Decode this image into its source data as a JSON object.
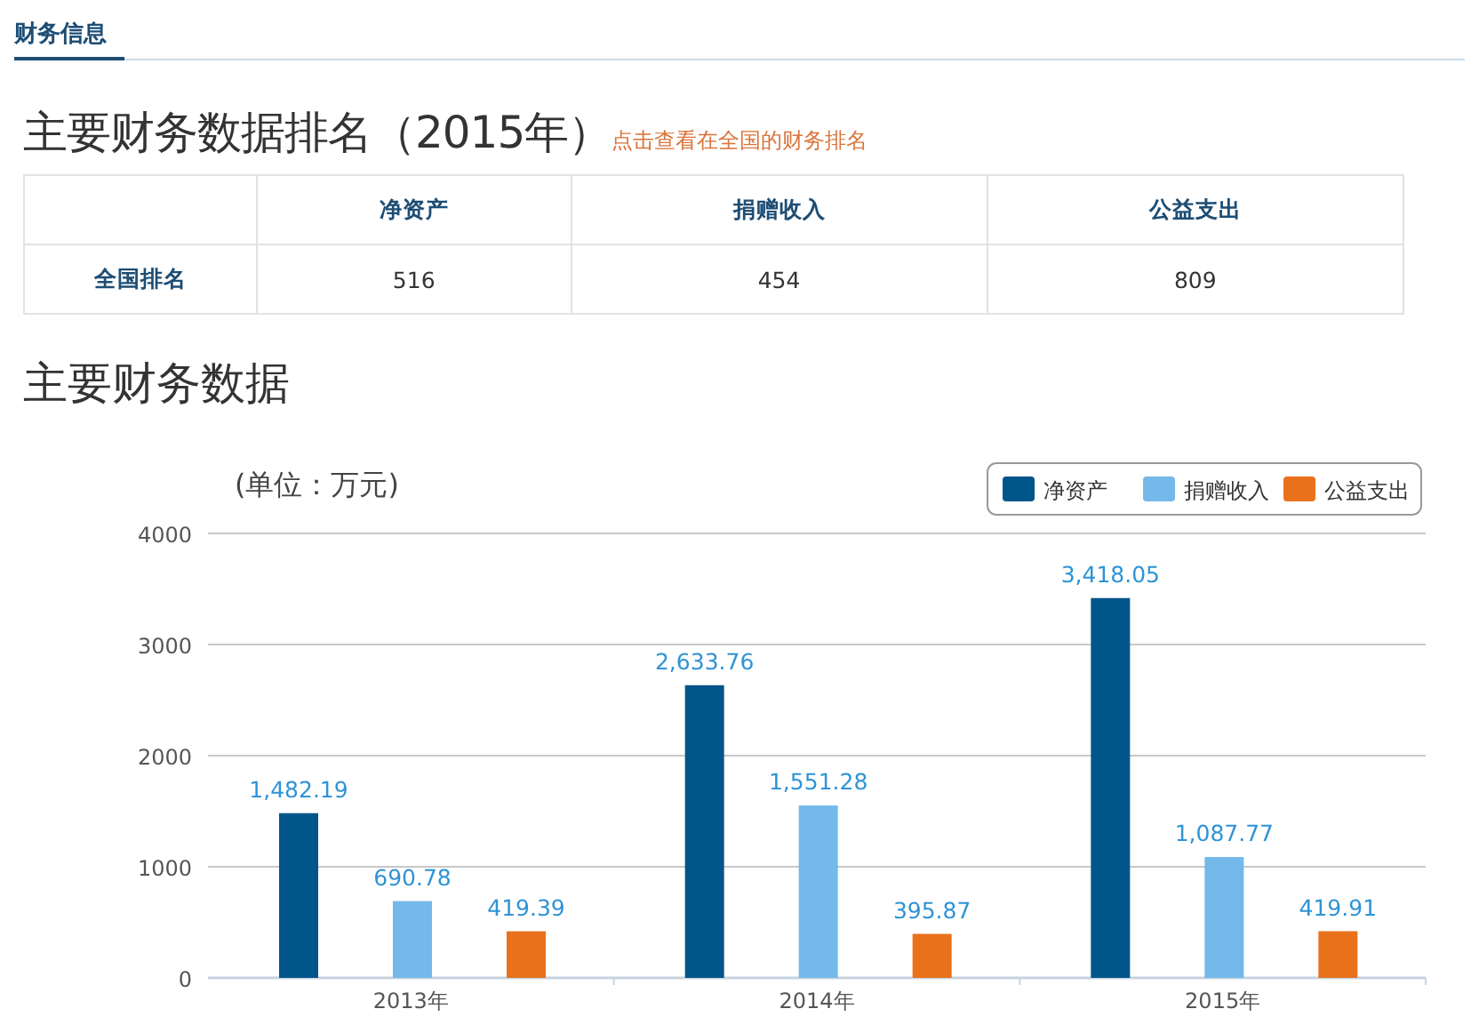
{
  "tabs": [
    {
      "label": "财务信息",
      "selected": true
    }
  ],
  "ranking": {
    "title": "主要财务数据排名（2015年）",
    "link": "点击查看在全国的财务排名",
    "columns": [
      "净资产",
      "捐赠收入",
      "公益支出"
    ],
    "rows": [
      {
        "label": "全国排名",
        "values": [
          "516",
          "454",
          "809"
        ]
      }
    ]
  },
  "financials": {
    "title": "主要财务数据",
    "unit": "(单位：万元)",
    "chart_data": {
      "type": "bar",
      "categories": [
        "2013年",
        "2014年",
        "2015年"
      ],
      "ylim": [
        0,
        4000
      ],
      "yticks": [
        0,
        1000,
        2000,
        3000,
        4000
      ],
      "data_labels": true,
      "grid": true,
      "legend": "top-right",
      "series": [
        {
          "name": "净资产",
          "color": "#00558a",
          "values": [
            1482.19,
            2633.76,
            3418.05
          ],
          "value_labels": [
            "1,482.19",
            "2,633.76",
            "3,418.05"
          ]
        },
        {
          "name": "捐赠收入",
          "color": "#74b9ea",
          "values": [
            690.78,
            1551.28,
            1087.77
          ],
          "value_labels": [
            "690.78",
            "1,551.28",
            "1,087.77"
          ]
        },
        {
          "name": "公益支出",
          "color": "#e9711c",
          "values": [
            419.39,
            395.87,
            419.91
          ],
          "value_labels": [
            "419.39",
            "395.87",
            "419.91"
          ]
        }
      ]
    }
  }
}
